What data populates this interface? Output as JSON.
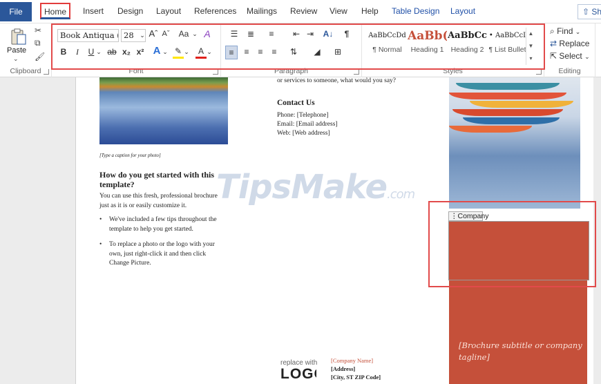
{
  "tabs": {
    "file": "File",
    "home": "Home",
    "insert": "Insert",
    "design": "Design",
    "layout": "Layout",
    "references": "References",
    "mailings": "Mailings",
    "review": "Review",
    "view": "View",
    "help": "Help",
    "table_design": "Table Design",
    "layout2": "Layout",
    "share": "Sh"
  },
  "ribbon": {
    "clipboard": {
      "label": "Clipboard",
      "paste": "Paste"
    },
    "font": {
      "label": "Font",
      "font_name": "Book Antiqua (He",
      "font_size": "28",
      "grow": "Aˆ",
      "shrink": "Aˇ",
      "change_case": "Aa",
      "clear_format": "A",
      "bold": "B",
      "italic": "I",
      "underline": "U",
      "strike": "ab",
      "subscript": "x₂",
      "superscript": "x²",
      "text_effects": "A",
      "highlight": "✎",
      "font_color": "A"
    },
    "paragraph": {
      "label": "Paragraph",
      "sort": "A↓",
      "pilcrow": "¶"
    },
    "styles": {
      "label": "Styles",
      "items": [
        {
          "sample": "AaBbCcDd",
          "name": "¶ Normal"
        },
        {
          "sample": "AaBb(",
          "name": "Heading 1"
        },
        {
          "sample": "AaBbCc",
          "name": "Heading 2"
        },
        {
          "sample": "• AaBbCcI",
          "name": "¶ List Bullet"
        }
      ]
    },
    "editing": {
      "label": "Editing",
      "find": "Find",
      "replace": "Replace",
      "select": "Select"
    }
  },
  "document": {
    "services_line": "or services to someone, what would you say?",
    "contact_heading": "Contact Us",
    "phone": "Phone: [Telephone]",
    "email": "Email: [Email address]",
    "web": "Web: [Web address]",
    "caption": "[Type a caption for your photo]",
    "heading_line1": "How do you get started with this",
    "heading_line2": "template?",
    "body_line1": "You can use this fresh, professional brochure",
    "body_line2": "just as it is or easily customize it.",
    "bullets": [
      {
        "line1": "We've included a few tips throughout the",
        "line2": "template to help you get started."
      },
      {
        "line1": "To replace a photo or the logo with your",
        "line2": "own, just right-click it and then click",
        "line3": "Change Picture."
      }
    ],
    "company_tag": "Company",
    "tagline_line1": "[Brochure subtitle or company",
    "tagline_line2": "tagline]",
    "logo_line1": "replace with",
    "logo_line2": "LOGO",
    "company_name": "[Company Name]",
    "address": "[Address]",
    "city": "[City, ST ZIP Code]"
  },
  "watermark": {
    "main": "TipsMake",
    "suffix": ".com"
  },
  "colors": {
    "accent": "#2b579a",
    "highlight_outline": "#e24a4a",
    "brochure_orange": "#c5503a"
  }
}
